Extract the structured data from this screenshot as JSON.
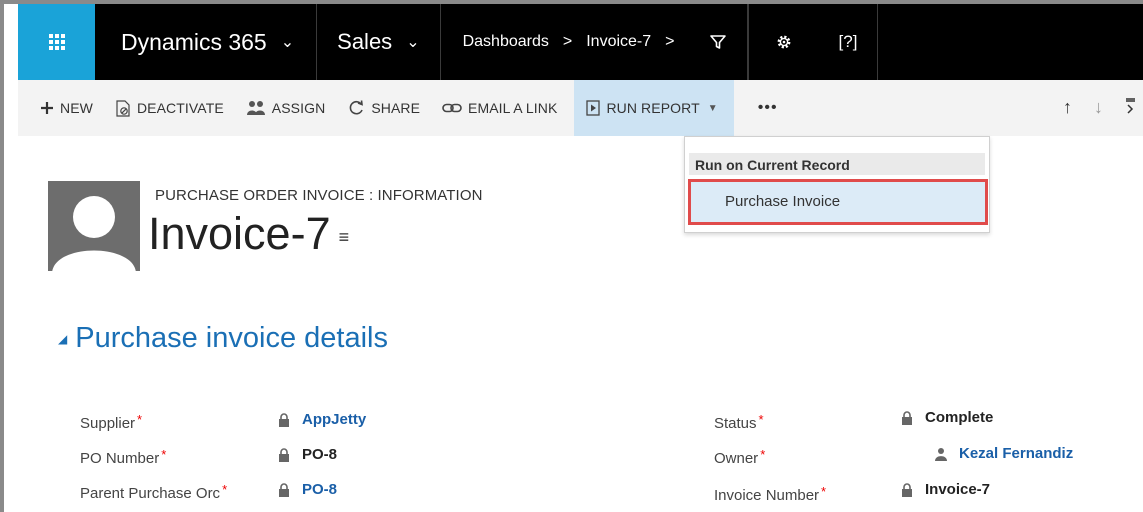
{
  "nav": {
    "brand": "Dynamics 365",
    "brand_chevron": "⌄",
    "app": "Sales",
    "app_chevron": "⌄",
    "crumb_1": "Dashboards",
    "crumb_sep_1": ">",
    "crumb_2": "Invoice-7",
    "crumb_sep_2": ">",
    "help": "[?]",
    "icons": [
      "waffle-icon",
      "filter-icon",
      "settings-gear-icon",
      "help-icon"
    ],
    "accent_color": "#1aa3d8"
  },
  "commands": {
    "new": "NEW",
    "deactivate": "DEACTIVATE",
    "assign": "ASSIGN",
    "share": "SHARE",
    "email_link": "EMAIL A LINK",
    "run_report": "RUN REPORT",
    "more": "•••",
    "up": "↑",
    "down": "↓"
  },
  "dropdown": {
    "header": "Run on Current Record",
    "item": "Purchase Invoice"
  },
  "record": {
    "entity_label": "PURCHASE ORDER INVOICE : INFORMATION",
    "title": "Invoice-7",
    "title_menu": "≡"
  },
  "section": {
    "title": "Purchase invoice details"
  },
  "fields": {
    "supplier_label": "Supplier",
    "supplier_value": "AppJetty",
    "po_number_label": "PO Number",
    "po_number_value": "PO-8",
    "parent_po_label": "Parent Purchase Orc",
    "parent_po_value": "PO-8",
    "status_label": "Status",
    "status_value": "Complete",
    "owner_label": "Owner",
    "owner_value": "Kezal Fernandiz",
    "invoice_number_label": "Invoice Number",
    "invoice_number_value": "Invoice-7",
    "required_mark": "*"
  }
}
